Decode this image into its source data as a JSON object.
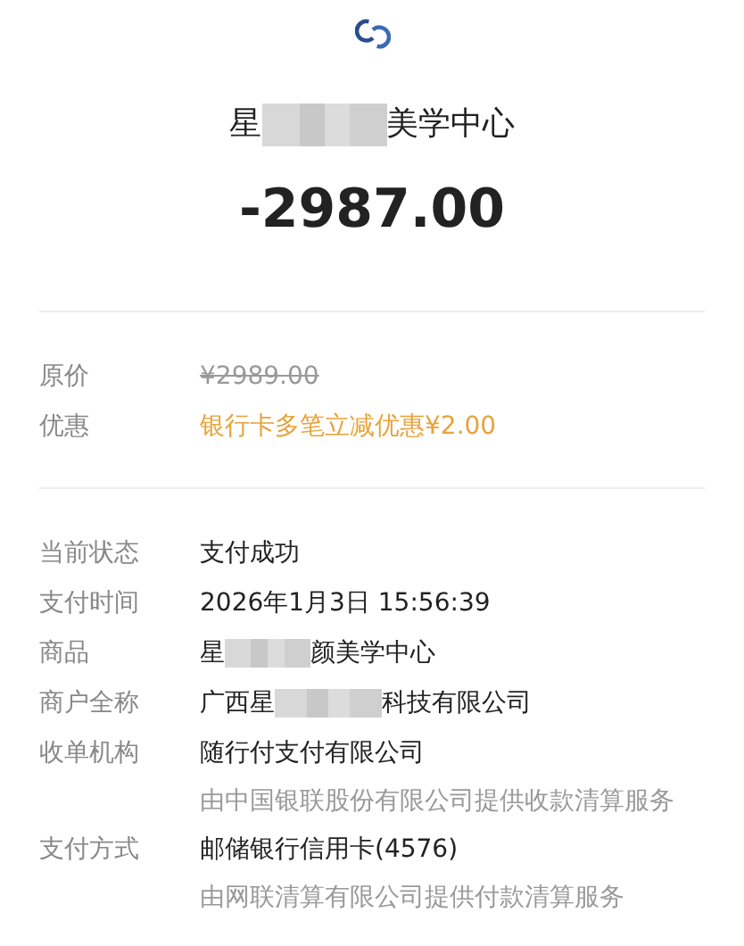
{
  "merchant": {
    "before": "星",
    "after": "美学中心"
  },
  "amount": "-2987.00",
  "price_rows": [
    {
      "kind": "strike",
      "label": "原价",
      "value": "¥2989.00"
    },
    {
      "kind": "discount",
      "label": "优惠",
      "value": "银行卡多笔立减优惠¥2.00"
    }
  ],
  "details": [
    {
      "label": "当前状态",
      "value": "支付成功"
    },
    {
      "label": "支付时间",
      "value": "2026年1月3日 15:56:39"
    },
    {
      "label": "商品",
      "before": "星",
      "after": "颜美学中心"
    },
    {
      "label": "商户全称",
      "before": "广西星",
      "after": "科技有限公司"
    },
    {
      "label": "收单机构",
      "value": "随行付支付有限公司",
      "note": "由中国银联股份有限公司提供收款清算服务"
    },
    {
      "label": "支付方式",
      "value": "邮储银行信用卡(4576)",
      "note": "由网联清算有限公司提供付款清算服务"
    }
  ]
}
